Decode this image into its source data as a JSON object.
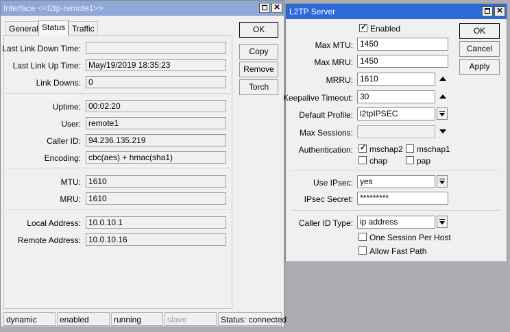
{
  "interface_window": {
    "title": "Interface <<l2tp-remote1>>",
    "tabs": [
      "General",
      "Status",
      "Traffic"
    ],
    "selected_tab": "Status",
    "buttons": {
      "ok": "OK",
      "copy": "Copy",
      "remove": "Remove",
      "torch": "Torch"
    },
    "fields": {
      "last_link_down_time": {
        "label": "Last Link Down Time:",
        "value": ""
      },
      "last_link_up_time": {
        "label": "Last Link Up Time:",
        "value": "May/19/2019 18:35:23"
      },
      "link_downs": {
        "label": "Link Downs:",
        "value": "0"
      },
      "uptime": {
        "label": "Uptime:",
        "value": "00:02:20"
      },
      "user": {
        "label": "User:",
        "value": "remote1"
      },
      "caller_id": {
        "label": "Caller ID:",
        "value": "94.236.135.219"
      },
      "encoding": {
        "label": "Encoding:",
        "value": "cbc(aes) + hmac(sha1)"
      },
      "mtu": {
        "label": "MTU:",
        "value": "1610"
      },
      "mru": {
        "label": "MRU:",
        "value": "1610"
      },
      "local_address": {
        "label": "Local Address:",
        "value": "10.0.10.1"
      },
      "remote_address": {
        "label": "Remote Address:",
        "value": "10.0.10.16"
      }
    },
    "statusbar": [
      "dynamic",
      "enabled",
      "running",
      "slave",
      "Status: connected"
    ]
  },
  "l2tp_window": {
    "title": "L2TP Server",
    "buttons": {
      "ok": "OK",
      "cancel": "Cancel",
      "apply": "Apply"
    },
    "enabled": {
      "label": "Enabled",
      "checked": true
    },
    "max_mtu": {
      "label": "Max MTU:",
      "value": "1450"
    },
    "max_mru": {
      "label": "Max MRU:",
      "value": "1450"
    },
    "mrru": {
      "label": "MRRU:",
      "value": "1610"
    },
    "keepalive_timeout": {
      "label": "Keepalive Timeout:",
      "value": "30"
    },
    "default_profile": {
      "label": "Default Profile:",
      "value": "l2tpIPSEC"
    },
    "max_sessions": {
      "label": "Max Sessions:",
      "value": ""
    },
    "authentication": {
      "label": "Authentication:",
      "mschap2": {
        "label": "mschap2",
        "checked": true
      },
      "mschap1": {
        "label": "mschap1",
        "checked": false
      },
      "chap": {
        "label": "chap",
        "checked": false
      },
      "pap": {
        "label": "pap",
        "checked": false
      }
    },
    "use_ipsec": {
      "label": "Use IPsec:",
      "value": "yes"
    },
    "ipsec_secret": {
      "label": "IPsec Secret:",
      "value": "*********"
    },
    "caller_id_type": {
      "label": "Caller ID Type:",
      "value": "ip address"
    },
    "one_session_per_host": {
      "label": "One Session Per Host",
      "checked": false
    },
    "allow_fast_path": {
      "label": "Allow Fast Path",
      "checked": false
    }
  },
  "colors": {
    "active_titlebar": "#2b6ad8",
    "inactive_titlebar": "#8fa8d6",
    "desktop": "#abadb3"
  }
}
